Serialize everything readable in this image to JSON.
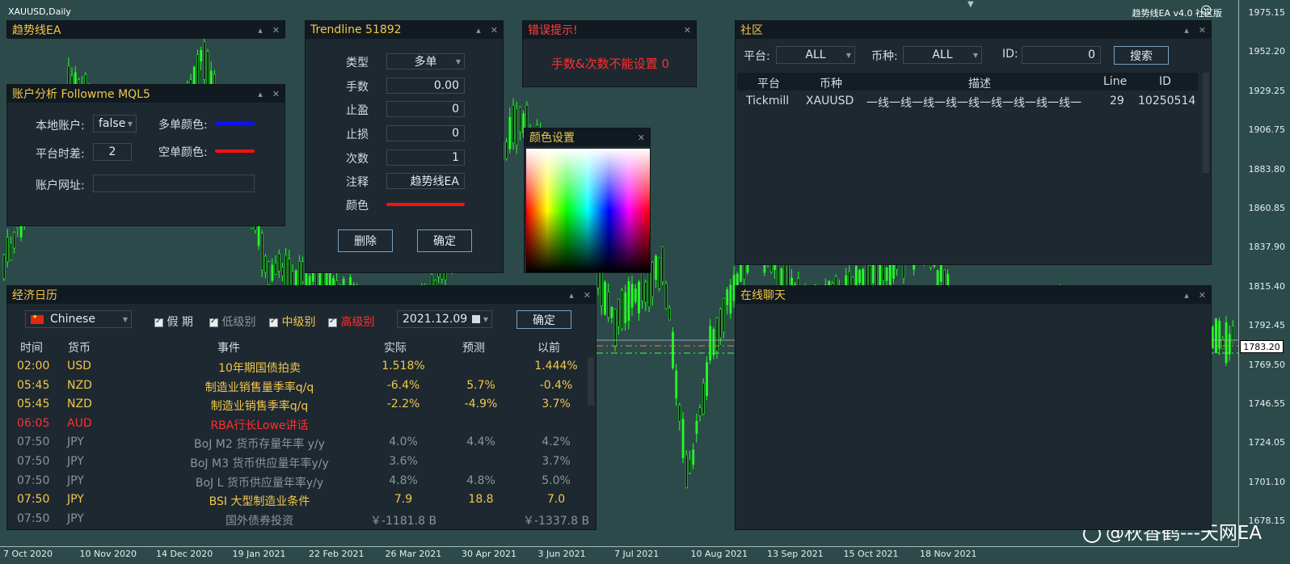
{
  "chart": {
    "title": "XAUUSD,Daily",
    "brand": "趋势线EA v4.0 社区版",
    "current_price": "1783.20",
    "price_levels": [
      "1975.15",
      "1952.20",
      "1929.25",
      "1906.75",
      "1883.80",
      "1860.85",
      "1837.90",
      "1815.40",
      "1792.45",
      "1769.50",
      "1746.55",
      "1724.05",
      "1701.10",
      "1678.15"
    ],
    "dates": [
      "7 Oct 2020",
      "10 Nov 2020",
      "14 Dec 2020",
      "19 Jan 2021",
      "22 Feb 2021",
      "26 Mar 2021",
      "30 Apr 2021",
      "3 Jun 2021",
      "7 Jul 2021",
      "10 Aug 2021",
      "13 Sep 2021",
      "15 Oct 2021",
      "18 Nov 2021"
    ],
    "watermark": "@秋香鹤---天网EA",
    "bull_color": "#22ff22",
    "bear_color": "#22ff22"
  },
  "trend_panel": {
    "title": "趋势线EA"
  },
  "account_panel": {
    "title": "账户分析  Followme  MQL5",
    "local_label": "本地账户:",
    "local_value": "false",
    "offset_label": "平台时差:",
    "offset_value": "2",
    "url_label": "账户网址:",
    "url_value": "",
    "long_color_label": "多单颜色:",
    "long_color": "#1010ff",
    "short_color_label": "空单颜色:",
    "short_color": "#ff1010"
  },
  "trendline_panel": {
    "title": "Trendline 51892",
    "fields": [
      {
        "label": "类型",
        "value": "多单"
      },
      {
        "label": "手数",
        "value": "0.00"
      },
      {
        "label": "止盈",
        "value": "0"
      },
      {
        "label": "止损",
        "value": "0"
      },
      {
        "label": "次数",
        "value": "1"
      },
      {
        "label": "注释",
        "value": "趋势线EA"
      },
      {
        "label": "颜色",
        "value": ""
      }
    ],
    "line_color": "#ff1010",
    "delete_label": "删除",
    "confirm_label": "确定"
  },
  "error_panel": {
    "title": "错误提示!",
    "message": "手数&次数不能设置 0"
  },
  "color_panel": {
    "title": "颜色设置"
  },
  "community_panel": {
    "title": "社区",
    "platform_label": "平台:",
    "platform_value": "ALL",
    "symbol_label": "币种:",
    "symbol_value": "ALL",
    "id_label": "ID:",
    "id_value": "0",
    "search_label": "搜索",
    "columns": [
      "平台",
      "币种",
      "描述",
      "Line",
      "ID"
    ],
    "rows": [
      {
        "platform": "Tickmill",
        "symbol": "XAUUSD",
        "desc": "一线一线一线一线一线一线一线一线一线一",
        "line": "29",
        "id": "10250514"
      }
    ]
  },
  "calendar_panel": {
    "title": "经济日历",
    "language": "Chinese",
    "filters": [
      {
        "label": "假  期",
        "color": "#d6dde2"
      },
      {
        "label": "低级别",
        "color": "#8b959b"
      },
      {
        "label": "中级别",
        "color": "#f3c74a"
      },
      {
        "label": "高级别",
        "color": "#ff3030"
      }
    ],
    "date_value": "2021.12.09",
    "confirm_label": "确定",
    "columns": [
      "时间",
      "货币",
      "事件",
      "实际",
      "预测",
      "以前"
    ],
    "rows": [
      {
        "time": "02:00",
        "currency": "USD",
        "event": "10年期国债拍卖",
        "actual": "1.518%",
        "forecast": "",
        "previous": "1.444%",
        "color": "#f3c74a"
      },
      {
        "time": "05:45",
        "currency": "NZD",
        "event": "制造业销售量季率q/q",
        "actual": "-6.4%",
        "forecast": "5.7%",
        "previous": "-0.4%",
        "color": "#f3c74a"
      },
      {
        "time": "05:45",
        "currency": "NZD",
        "event": "制造业销售季率q/q",
        "actual": "-2.2%",
        "forecast": "-4.9%",
        "previous": "3.7%",
        "color": "#f3c74a"
      },
      {
        "time": "06:05",
        "currency": "AUD",
        "event": "RBA行长Lowe讲话",
        "actual": "",
        "forecast": "",
        "previous": "",
        "color": "#ff3030"
      },
      {
        "time": "07:50",
        "currency": "JPY",
        "event": "BoJ M2 货币存量年率 y/y",
        "actual": "4.0%",
        "forecast": "4.4%",
        "previous": "4.2%",
        "color": "#8b959b"
      },
      {
        "time": "07:50",
        "currency": "JPY",
        "event": "BoJ M3 货币供应量年率y/y",
        "actual": "3.6%",
        "forecast": "",
        "previous": "3.7%",
        "color": "#8b959b"
      },
      {
        "time": "07:50",
        "currency": "JPY",
        "event": "BoJ L 货币供应量年率y/y",
        "actual": "4.8%",
        "forecast": "4.8%",
        "previous": "5.0%",
        "color": "#8b959b"
      },
      {
        "time": "07:50",
        "currency": "JPY",
        "event": "BSI 大型制造业条件",
        "actual": "7.9",
        "forecast": "18.8",
        "previous": "7.0",
        "color": "#f3c74a"
      },
      {
        "time": "07:50",
        "currency": "JPY",
        "event": "国外债券投资",
        "actual": "￥-1181.8 B",
        "forecast": "",
        "previous": "￥-1337.8 B",
        "color": "#8b959b"
      }
    ]
  },
  "chat_panel": {
    "title": "在线聊天"
  }
}
